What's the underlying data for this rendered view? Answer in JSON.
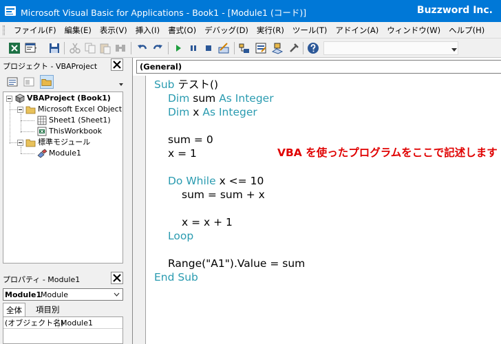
{
  "window": {
    "title": "Microsoft Visual Basic for Applications - Book1 - [Module1 (コード)]",
    "brand": "Buzzword Inc."
  },
  "menu": [
    "ファイル(F)",
    "編集(E)",
    "表示(V)",
    "挿入(I)",
    "書式(O)",
    "デバッグ(D)",
    "実行(R)",
    "ツール(T)",
    "アドイン(A)",
    "ウィンドウ(W)",
    "ヘルプ(H)"
  ],
  "toolbar_icons": [
    "excel-view-icon",
    "insert-module-icon",
    "save-icon",
    "cut-icon",
    "copy-icon",
    "paste-icon",
    "find-icon",
    "undo-icon",
    "redo-icon",
    "run-icon",
    "break-icon",
    "reset-icon",
    "design-mode-icon",
    "project-explorer-icon",
    "properties-window-icon",
    "object-browser-icon",
    "toolbox-icon",
    "help-icon"
  ],
  "project_pane": {
    "title": "プロジェクト - VBAProject",
    "tree": {
      "project": "VBAProject (Book1)",
      "excel_objects_folder": "Microsoft Excel Object",
      "sheet1": "Sheet1 (Sheet1)",
      "workbook": "ThisWorkbook",
      "modules_folder": "標準モジュール",
      "module1": "Module1"
    }
  },
  "properties_pane": {
    "title": "プロパティ - Module1",
    "object_name": "Module1",
    "object_type": "Module",
    "tabs": [
      "全体",
      "項目別"
    ],
    "rows": [
      {
        "key": "(オブジェクト名)",
        "value": "Module1"
      }
    ]
  },
  "code_window": {
    "object_combo": "(General)",
    "annotation": "VBA を使ったプログラムをここで記述します",
    "keywords": {
      "sub": "Sub",
      "dim": "Dim",
      "as_integer": "As Integer",
      "do_while": "Do While",
      "loop": "Loop",
      "end_sub": "End Sub"
    },
    "text": {
      "sub_name": " テスト()",
      "dim_sum": " sum ",
      "dim_x": " x ",
      "sum_init": "sum = 0",
      "x_init": "x = 1",
      "cond": " x <= 10",
      "sum_add": "sum = sum + x",
      "x_inc": "x = x + 1",
      "range_assign": "Range(\"A1\").Value = sum"
    }
  },
  "colors": {
    "titlebar": "#0078d7",
    "keyword": "#2a9bb0",
    "annotation": "#e00000"
  }
}
